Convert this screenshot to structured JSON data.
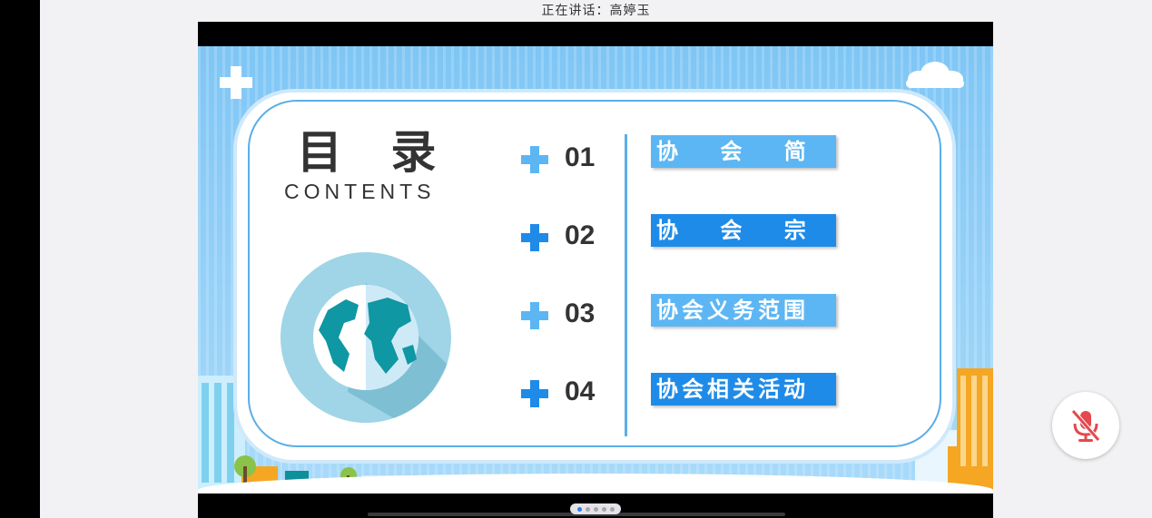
{
  "header": {
    "speaking_label": "正在讲话：高婷玉"
  },
  "slide": {
    "title_cn": "目 录",
    "title_en": "CONTENTS",
    "items": [
      {
        "number": "01",
        "label": "协 会 简 介",
        "box_color": "#5cb6f3",
        "plus_color": "#5cb6f3"
      },
      {
        "number": "02",
        "label": "协 会 宗 旨",
        "box_color": "#1f8be8",
        "plus_color": "#1f8be8"
      },
      {
        "number": "03",
        "label": "协会义务范围",
        "box_color": "#5cb6f3",
        "plus_color": "#5cb6f3"
      },
      {
        "number": "04",
        "label": "协会相关活动",
        "box_color": "#1f8be8",
        "plus_color": "#1f8be8"
      }
    ]
  },
  "controls": {
    "mic_icon": "mic-muted-icon",
    "mic_color": "#e5484d",
    "pager": {
      "count": 5,
      "active_index": 0
    }
  },
  "colors": {
    "accent": "#5aaee8",
    "sky": "#8fcdf6"
  }
}
